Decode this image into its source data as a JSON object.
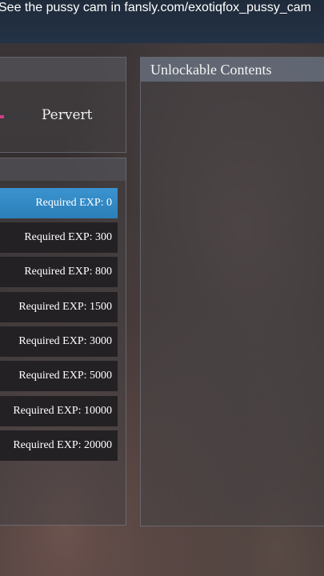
{
  "banner": {
    "text": "See the pussy cam in fansly.com/exotiqfox_pussy_cam"
  },
  "rank": {
    "label": "Pervert"
  },
  "levels": [
    {
      "label": "Required EXP: 0",
      "active": true
    },
    {
      "label": "Required EXP: 300",
      "active": false
    },
    {
      "label": "Required EXP: 800",
      "active": false
    },
    {
      "label": "Required EXP: 1500",
      "active": false
    },
    {
      "label": "Required EXP: 3000",
      "active": false
    },
    {
      "label": "Required EXP: 5000",
      "active": false
    },
    {
      "label": "Required EXP: 10000",
      "active": false
    },
    {
      "label": "Required EXP: 20000",
      "active": false
    }
  ],
  "unlockables": {
    "title": "Unlockable Contents"
  },
  "colors": {
    "active": "#2f86c2",
    "rank_bar_fill": "#d23c8a"
  }
}
